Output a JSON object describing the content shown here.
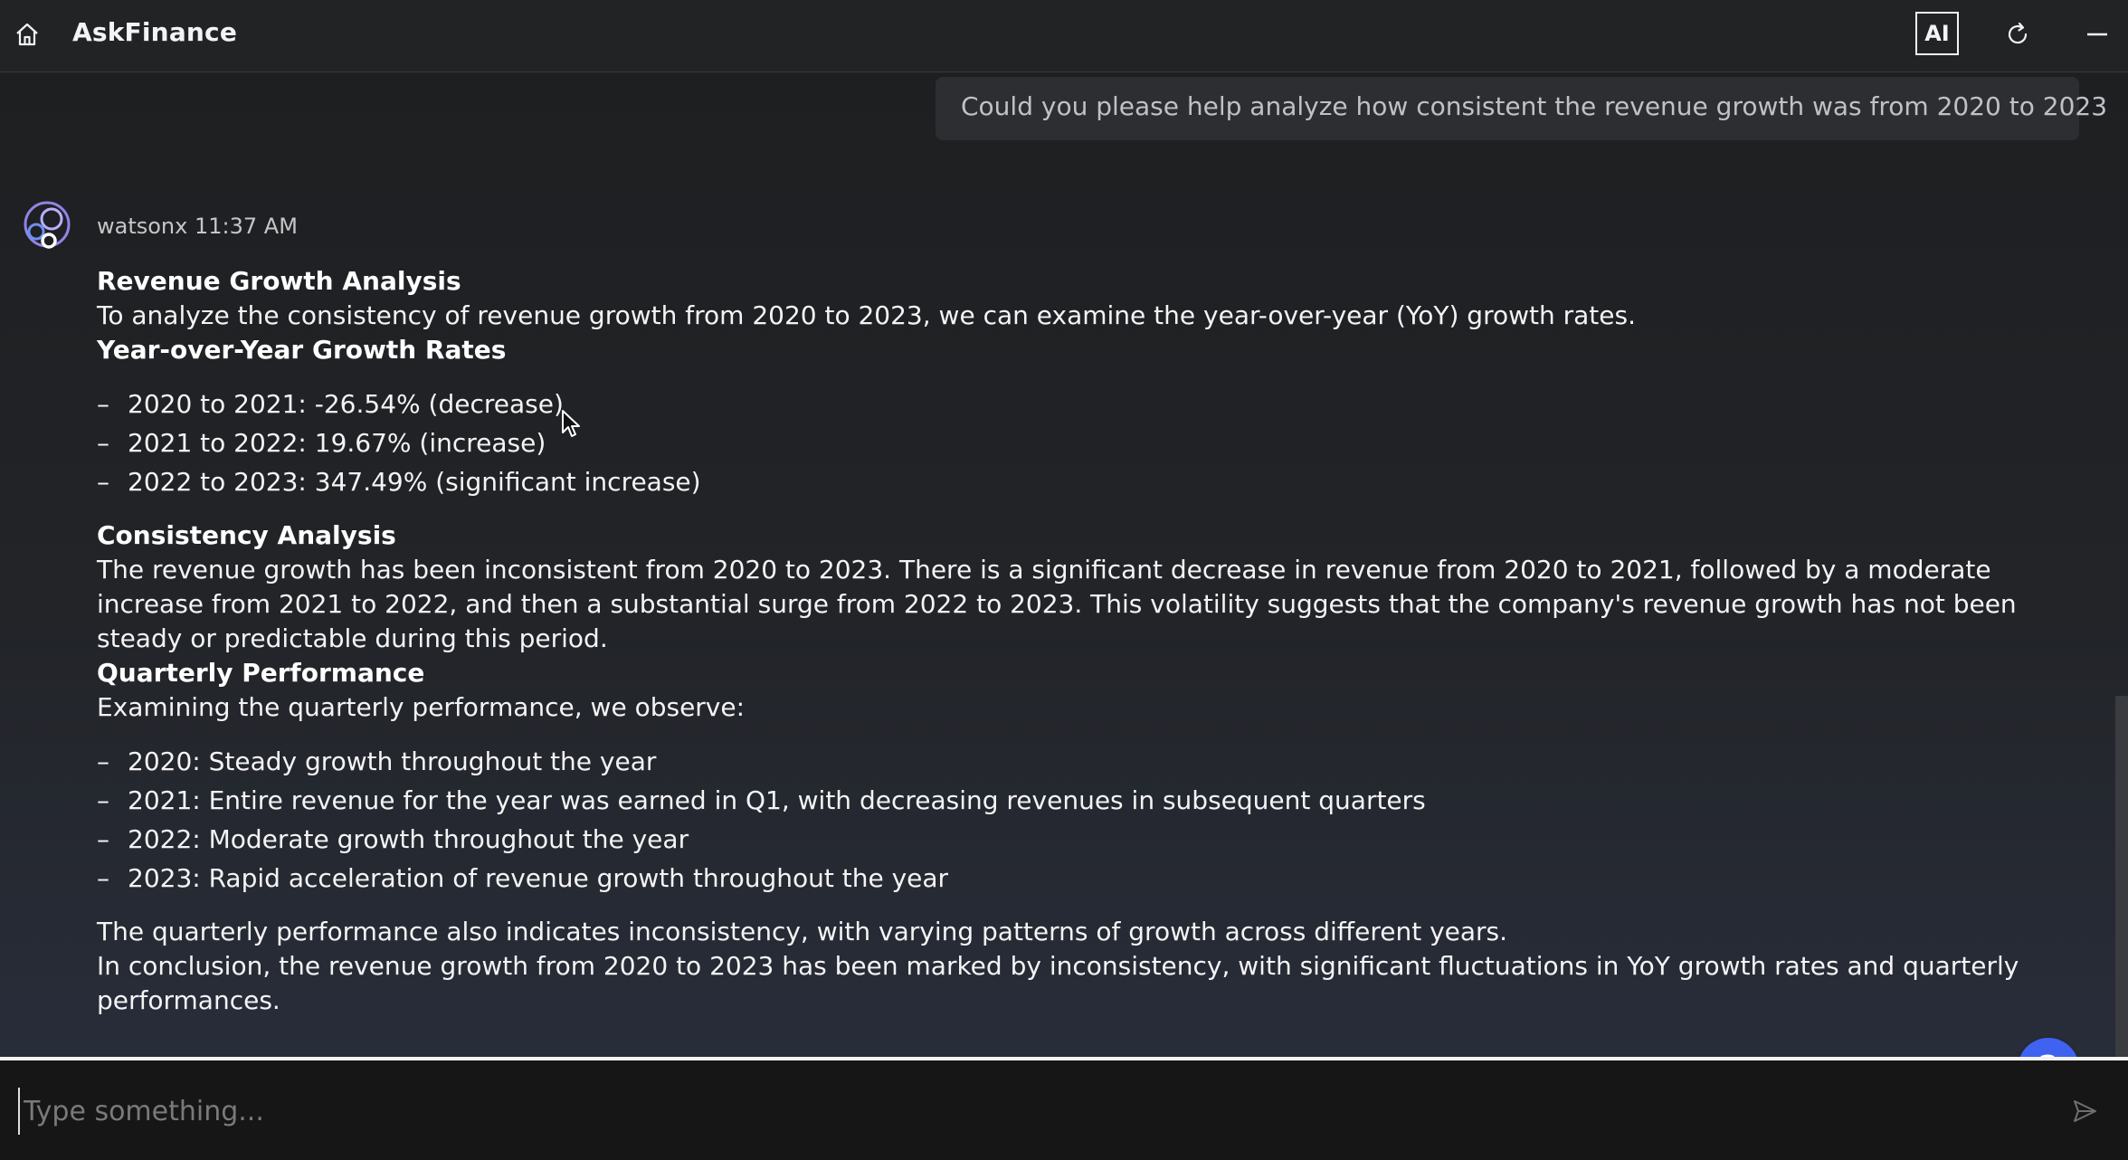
{
  "header": {
    "title": "AskFinance",
    "ai_label": "AI",
    "icons": {
      "home": "home-icon",
      "refresh": "refresh-icon",
      "minimize": "minimize-icon"
    }
  },
  "conversation": {
    "user_message": "Could you please help analyze how consistent the revenue growth was from 2020 to 2023",
    "assistant": {
      "name": "watsonx",
      "time": "11:37 AM",
      "title": "Revenue Growth Analysis",
      "intro": "To analyze the consistency of revenue growth from 2020 to 2023, we can examine the year-over-year (YoY) growth rates.",
      "yoy_heading": "Year-over-Year Growth Rates",
      "yoy_items": [
        "2020 to 2021: -26.54% (decrease)",
        "2021 to 2022: 19.67% (increase)",
        "2022 to 2023: 347.49% (significant increase)"
      ],
      "consistency_heading": "Consistency Analysis",
      "consistency_text": "The revenue growth has been inconsistent from 2020 to 2023. There is a significant decrease in revenue from 2020 to 2021, followed by a moderate increase from 2021 to 2022, and then a substantial surge from 2022 to 2023. This volatility suggests that the company's revenue growth has not been steady or predictable during this period.",
      "quarterly_heading": "Quarterly Performance",
      "quarterly_intro": "Examining the quarterly performance, we observe:",
      "quarterly_items": [
        "2020: Steady growth throughout the year",
        "2021: Entire revenue for the year was earned in Q1, with decreasing revenues in subsequent quarters",
        "2022: Moderate growth throughout the year",
        "2023: Rapid acceleration of revenue growth throughout the year"
      ],
      "quarterly_summary": "The quarterly performance also indicates inconsistency, with varying patterns of growth across different years.",
      "conclusion": "In conclusion, the revenue growth from 2020 to 2023 has been marked by inconsistency, with significant fluctuations in YoY growth rates and quarterly performances."
    }
  },
  "list_dash": "–",
  "help_label": "?",
  "input": {
    "placeholder": "Type something...",
    "value": ""
  },
  "colors": {
    "help_button": "#3f63f0",
    "background": "#1e1f21",
    "text": "#f4f4f4"
  }
}
